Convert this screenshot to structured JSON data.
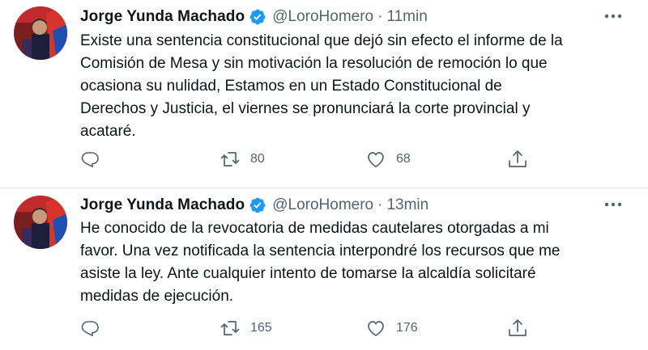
{
  "tweets": [
    {
      "name": "Jorge Yunda Machado",
      "handle": "@LoroHomero",
      "separator": "·",
      "time": "11min",
      "text": "Existe una sentencia constitucional que dejó sin efecto el informe de la\nComisión de Mesa y sin motivación la resolución de remoción lo que\nocasiona su nulidad, Estamos en un Estado Constitucional de\nDerechos y Justicia, el viernes se pronunciará la corte provincial y\nacataré.",
      "retweets": "80",
      "likes": "68"
    },
    {
      "name": "Jorge Yunda Machado",
      "handle": "@LoroHomero",
      "separator": "·",
      "time": "13min",
      "text": "He conocido de la revocatoria de medidas cautelares otorgadas a mi\nfavor. Una vez notificada la sentencia interpondré los recursos que me\nasiste la ley. Ante cualquier intento de tomarse la alcaldía solicitaré\nmedidas de ejecución.",
      "retweets": "165",
      "likes": "176"
    }
  ],
  "colors": {
    "verified": "#1d9bf0",
    "muted": "#536471",
    "text": "#0f1419"
  },
  "icons": [
    "verified-badge-icon",
    "more-icon",
    "reply-icon",
    "retweet-icon",
    "like-icon",
    "share-icon"
  ]
}
